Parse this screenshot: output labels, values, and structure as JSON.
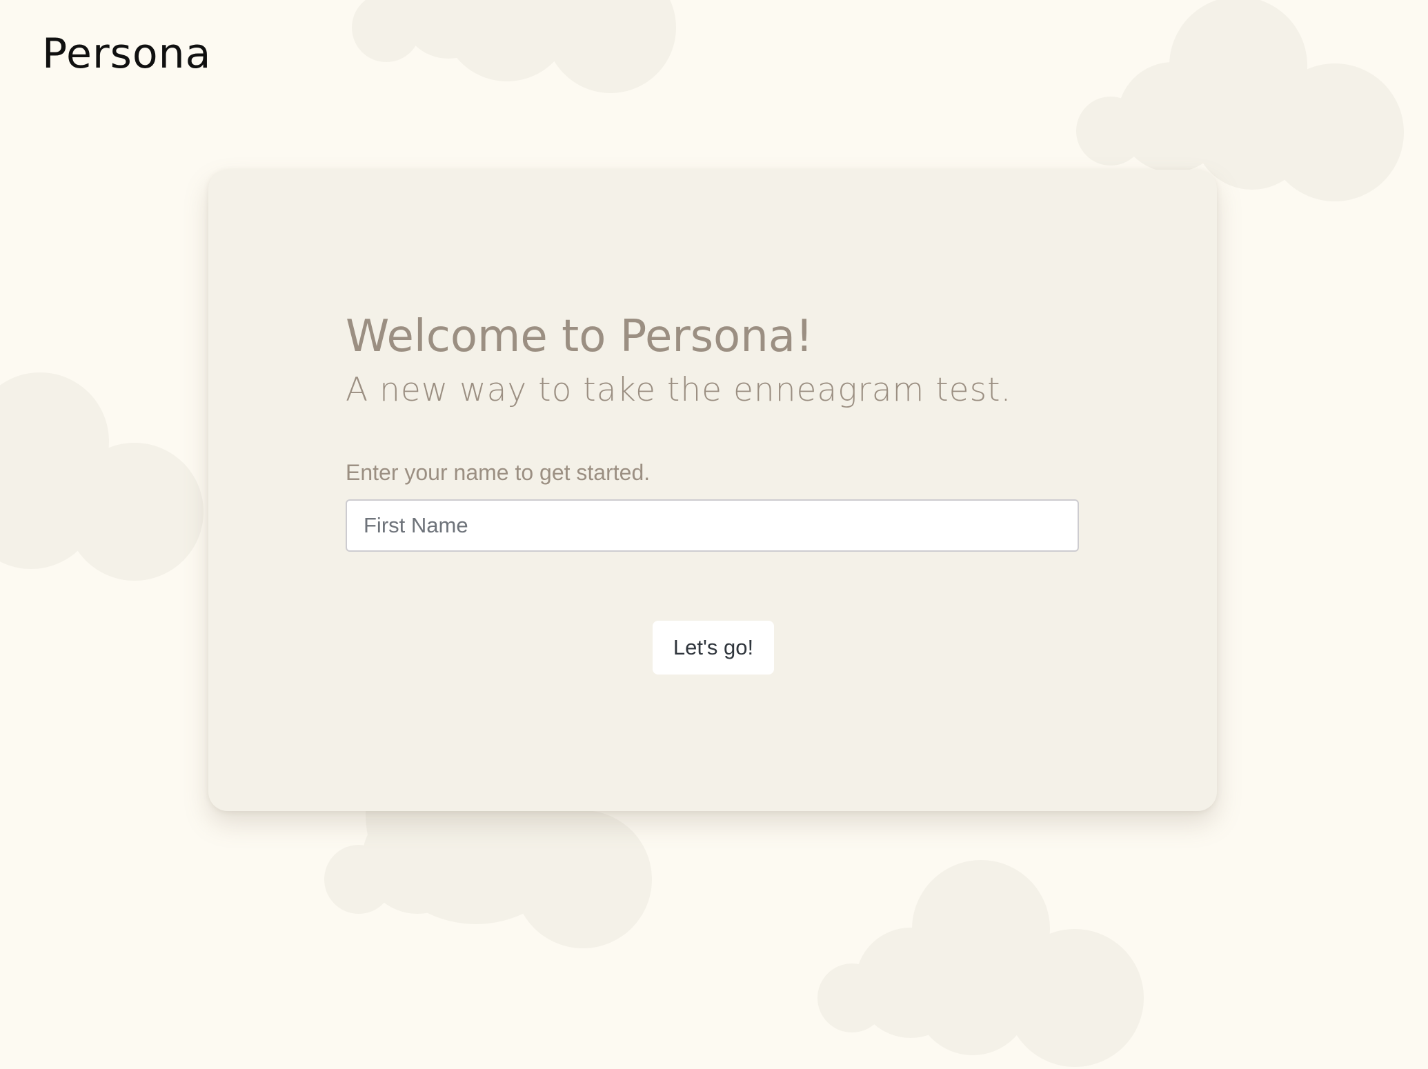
{
  "header": {
    "brand": "Persona"
  },
  "welcome": {
    "title": "Welcome to Persona!",
    "subtitle": "A new way to take the enneagram test.",
    "name_prompt": "Enter your name to get started.",
    "name_input": {
      "placeholder": "First Name",
      "value": ""
    },
    "submit_label": "Let's go!"
  },
  "colors": {
    "page_background": "#fdfaf2",
    "card_background": "#f4f1e8",
    "cloud": "#f4f1e8",
    "heading_text": "#9b8f82",
    "brand_text": "#101010",
    "button_background": "#ffffff"
  }
}
